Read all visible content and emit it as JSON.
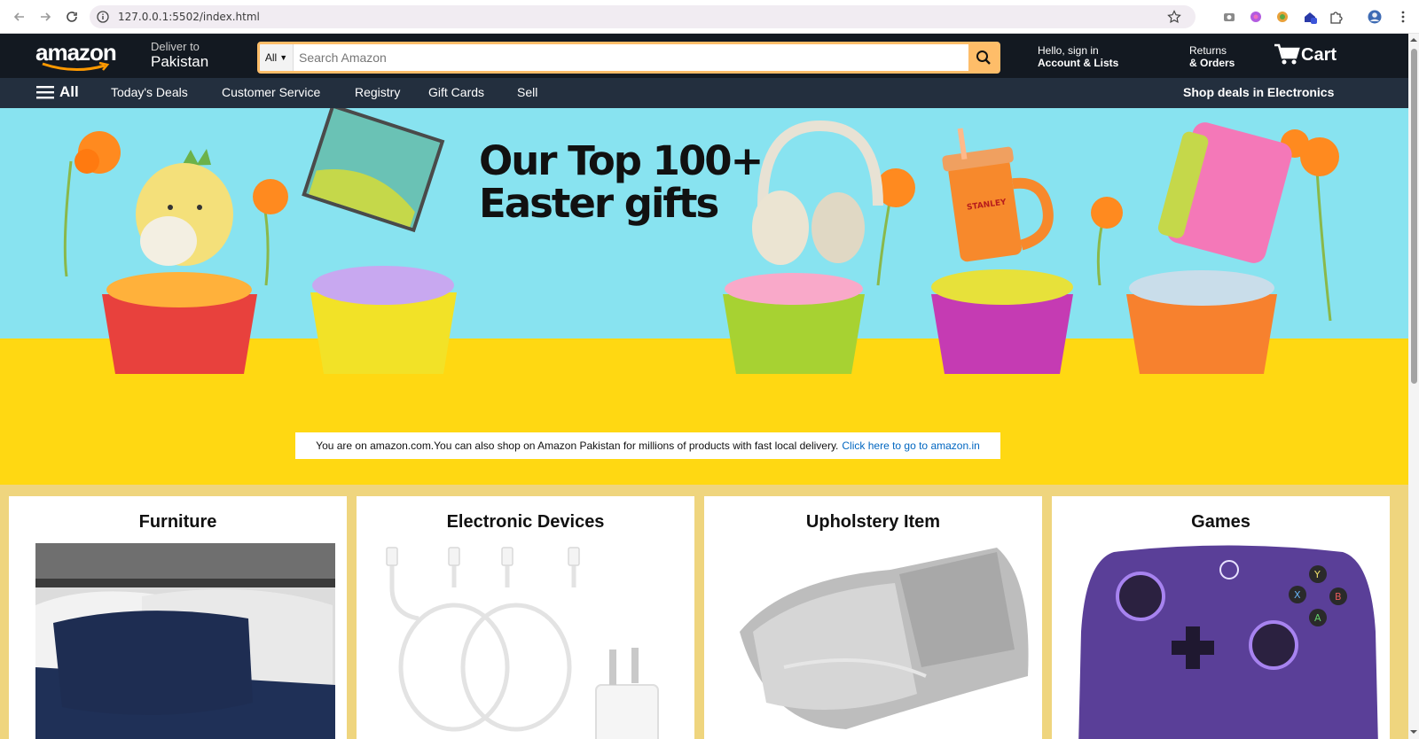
{
  "browser": {
    "url": "127.0.0.1:5502/index.html"
  },
  "header": {
    "logo_text": "amazon",
    "deliver_line1": "Deliver to",
    "deliver_line2": "Pakistan",
    "search_category": "All",
    "search_placeholder": "Search Amazon",
    "account_line1": "Hello, sign in",
    "account_line2": "Account & Lists",
    "returns_line1": "Returns",
    "returns_line2": "& Orders",
    "cart_label": "Cart"
  },
  "subnav": {
    "all_label": "All",
    "items": [
      "Today's Deals",
      "Customer Service",
      "Registry",
      "Gift Cards",
      "Sell"
    ],
    "promo": "Shop deals in Electronics"
  },
  "hero": {
    "headline_line1": "Our Top 100+",
    "headline_line2": "Easter gifts",
    "notice_text": "You are on amazon.com.You can also shop on Amazon Pakistan for millions of products with fast local delivery.",
    "notice_link": "Click here to go to amazon.in"
  },
  "cards": [
    {
      "title": "Furniture"
    },
    {
      "title": "Electronic Devices"
    },
    {
      "title": "Upholstery Item"
    },
    {
      "title": "Games"
    }
  ],
  "colors": {
    "header_bg": "#131921",
    "subnav_bg": "#232f3e",
    "search_accent": "#febd69",
    "hero_sky": "#88e3f0",
    "hero_floor": "#ffd812",
    "cards_bg": "#efd57e",
    "link": "#0066c0"
  }
}
